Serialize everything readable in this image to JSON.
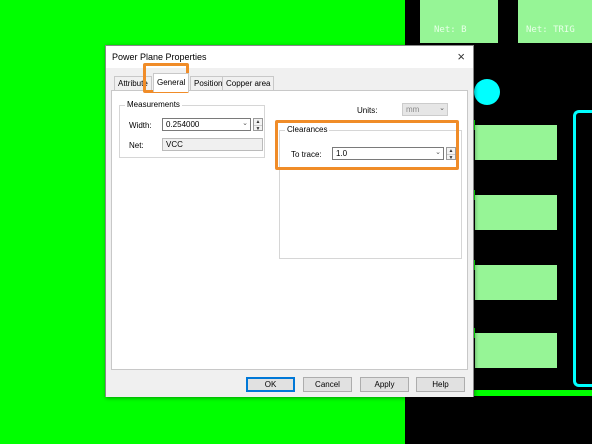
{
  "pcb": {
    "pad_labels": [
      "Net: B",
      "Net: TRIG"
    ],
    "colors": {
      "board": "#00ff00",
      "pad": "#96f596",
      "via": "#00ffff",
      "highlight": "#f08c28"
    }
  },
  "dialog": {
    "title": "Power Plane Properties",
    "close_icon": "×",
    "tabs": [
      "Attribute",
      "General",
      "Position",
      "Copper area"
    ],
    "active_tab": "General",
    "measurements": {
      "title": "Measurements",
      "width_label": "Width:",
      "width_value": "0.254000",
      "net_label": "Net:",
      "net_value": "VCC"
    },
    "units": {
      "label": "Units:",
      "value": "mm"
    },
    "clearances": {
      "title": "Clearances",
      "to_trace_label": "To trace:",
      "to_trace_value": "1.0"
    },
    "buttons": {
      "ok": "OK",
      "cancel": "Cancel",
      "apply": "Apply",
      "help": "Help"
    }
  }
}
